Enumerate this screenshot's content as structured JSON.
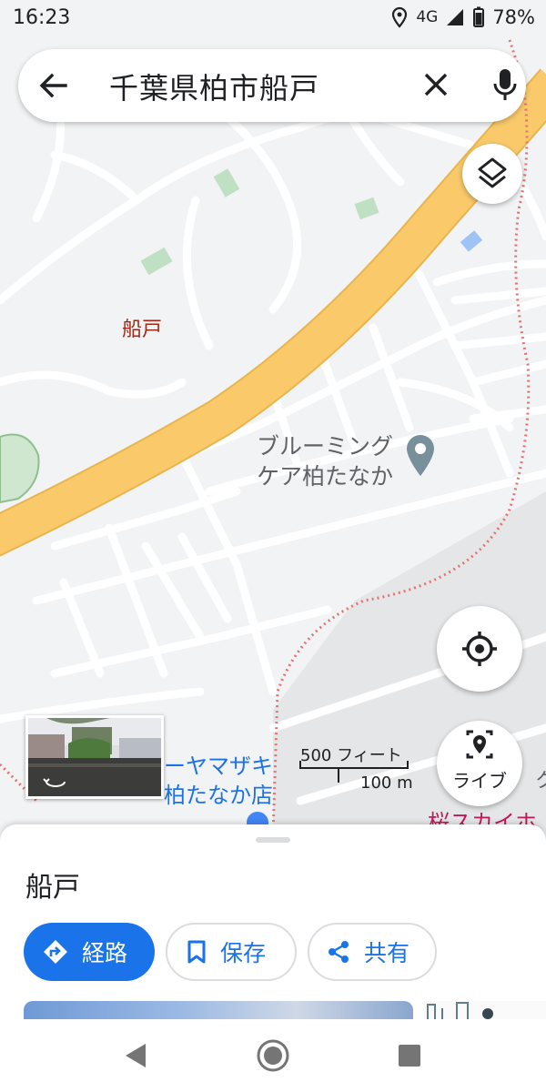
{
  "status_bar": {
    "time": "16:23",
    "network": "4G",
    "battery": "78%"
  },
  "search": {
    "query": "千葉県柏市船戸"
  },
  "map": {
    "area_label": "船戸",
    "poi_name_line1": "ブルーミング",
    "poi_name_line2": "ケア柏たなか",
    "shop_line1": "ーヤマザキ",
    "shop_line2": "柏たなか店",
    "partial_label": "桜スカイホ",
    "scale_feet": "500 フィート",
    "scale_meters": "100 m",
    "live_label": "ライブ",
    "partial_right_char": "ク"
  },
  "sheet": {
    "title": "船戸",
    "route_label": "経路",
    "save_label": "保存",
    "share_label": "共有"
  },
  "colors": {
    "accent": "#1a73e8",
    "highway": "#f9c96a",
    "boundary": "#d93025"
  }
}
